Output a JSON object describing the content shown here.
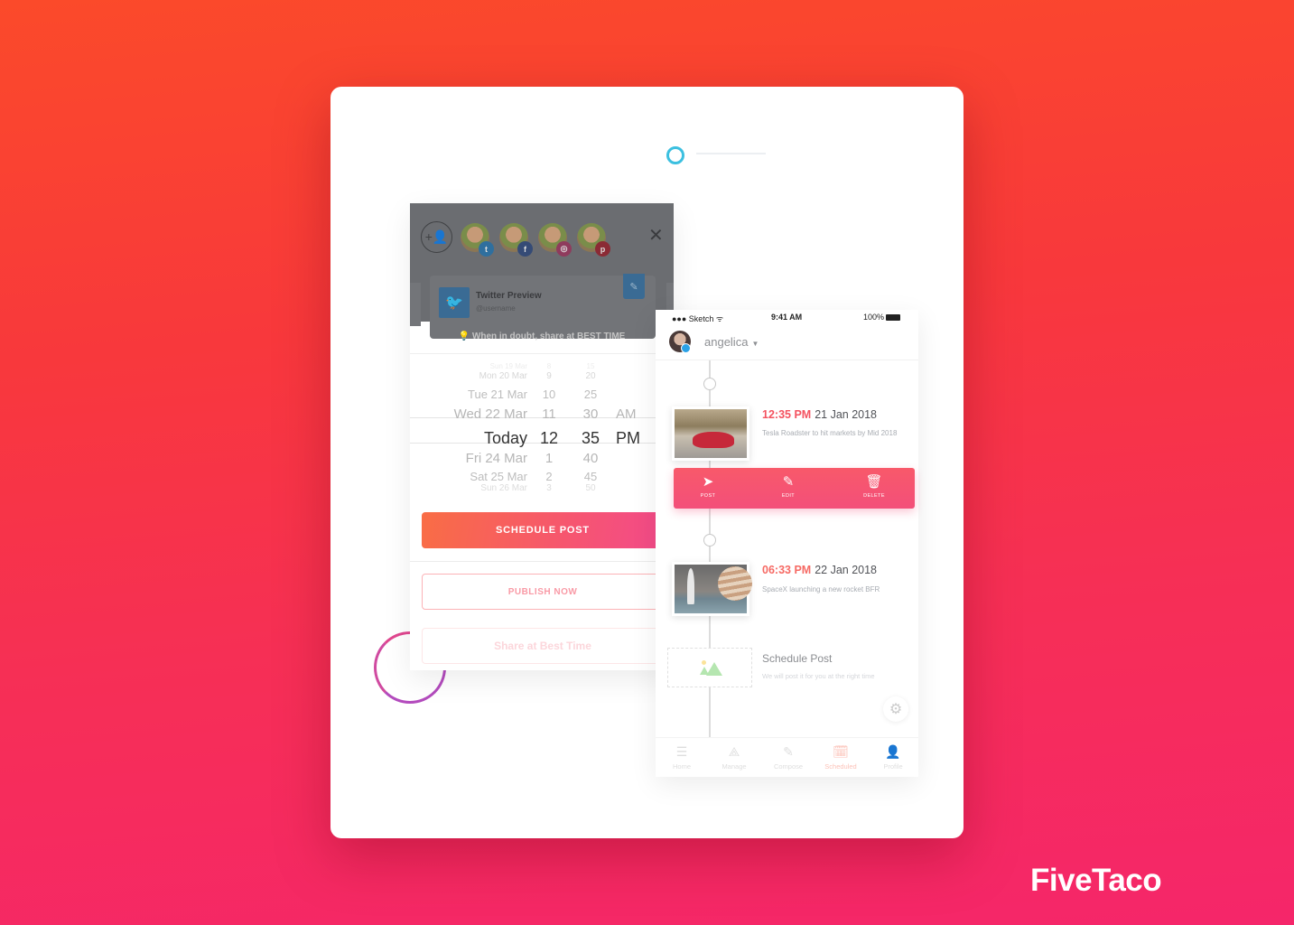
{
  "brand": {
    "name": "FiveTaco"
  },
  "colors": {
    "bg_top": "#fb4a2a",
    "bg_bottom": "#f5266a",
    "accent_red": "#f4525f",
    "accent_pink": "#f34a8a",
    "ring_top": "#3cc0e0",
    "ring_left": "#b34bbd"
  },
  "schedule_panel": {
    "overlay": {
      "add_user_icon": "add-user-icon",
      "accounts": [
        {
          "network": "twitter",
          "badge_glyph": "t",
          "badge_color": "#2f6f9e"
        },
        {
          "network": "facebook",
          "badge_glyph": "f",
          "badge_color": "#354b76"
        },
        {
          "network": "instagram",
          "badge_glyph": "◎",
          "badge_color": "#8f3b5d"
        },
        {
          "network": "pinterest",
          "badge_glyph": "p",
          "badge_color": "#8b2a35"
        }
      ],
      "close_glyph": "✕",
      "preview_title": "Twitter Preview",
      "preview_handle": "@username"
    },
    "hint": {
      "bulb": "💡",
      "text": "When in doubt, share at BEST TIME"
    },
    "picker": {
      "rows": [
        {
          "day": "Sun 19 Mar",
          "hour": "8",
          "minute": "15",
          "ampm": ""
        },
        {
          "day": "Mon 20 Mar",
          "hour": "9",
          "minute": "20",
          "ampm": ""
        },
        {
          "day": "Tue 21 Mar",
          "hour": "10",
          "minute": "25",
          "ampm": ""
        },
        {
          "day": "Wed 22 Mar",
          "hour": "11",
          "minute": "30",
          "ampm": "AM"
        },
        {
          "day": "Today",
          "hour": "12",
          "minute": "35",
          "ampm": "PM"
        },
        {
          "day": "Fri 24 Mar",
          "hour": "1",
          "minute": "40",
          "ampm": ""
        },
        {
          "day": "Sat 25 Mar",
          "hour": "2",
          "minute": "45",
          "ampm": ""
        },
        {
          "day": "Sun 26 Mar",
          "hour": "3",
          "minute": "50",
          "ampm": ""
        }
      ],
      "selected_index": 4
    },
    "buttons": {
      "schedule": "SCHEDULE POST",
      "publish": "PUBLISH NOW",
      "best_time": "Share at Best Time"
    }
  },
  "phone": {
    "status": {
      "carrier": "●●● Sketch",
      "wifi": "ᯤ",
      "time": "9:41 AM",
      "battery": "100%"
    },
    "account": {
      "name": "angelica",
      "caret": "▼"
    },
    "posts": [
      {
        "time": "12:35 PM",
        "date": "21 Jan 2018",
        "desc": "Tesla Roadster to hit markets by Mid 2018",
        "time_color": "#f4525f"
      },
      {
        "time": "06:33 PM",
        "date": "22 Jan 2018",
        "desc": "SpaceX launching a new rocket BFR",
        "time_color": "#f66a64"
      }
    ],
    "actions": [
      {
        "icon": "➤",
        "label": "POST"
      },
      {
        "icon": "✎",
        "label": "EDIT"
      },
      {
        "icon": "🗑",
        "label": "DELETE"
      }
    ],
    "placeholder": {
      "title": "Schedule Post",
      "desc": "We will post it for you at the right time"
    },
    "settings_glyph": "⚙",
    "tabs": [
      {
        "icon": "☰",
        "label": "Home",
        "active": false
      },
      {
        "icon": "⟁",
        "label": "Manage",
        "active": false
      },
      {
        "icon": "✎",
        "label": "Compose",
        "active": false
      },
      {
        "icon": "🗓",
        "label": "Scheduled",
        "active": true
      },
      {
        "icon": "👤",
        "label": "Profile",
        "active": false
      }
    ]
  }
}
